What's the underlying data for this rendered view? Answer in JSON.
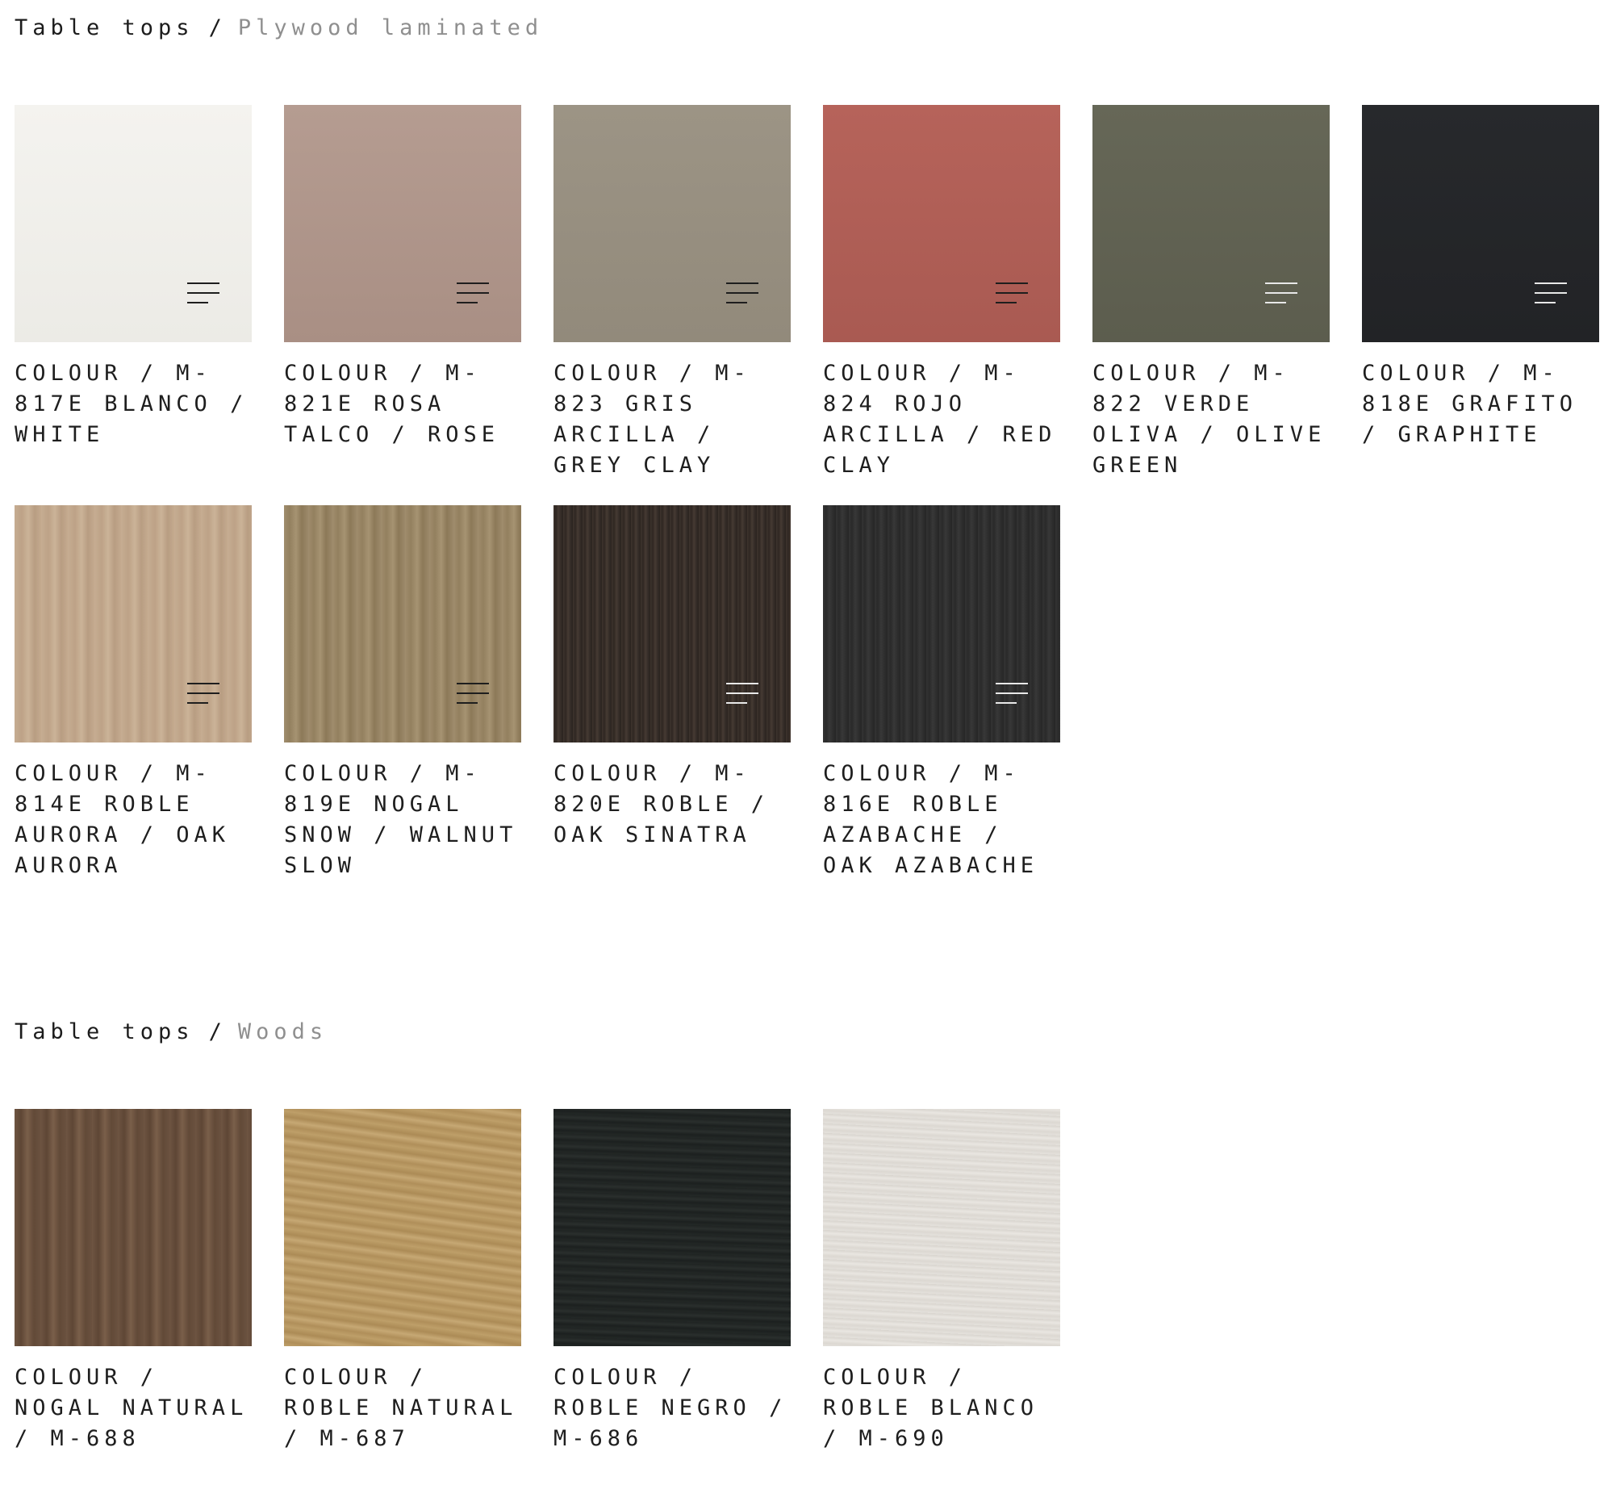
{
  "sections": [
    {
      "breadcrumb": {
        "main": "Table tops",
        "sep": "/",
        "sub": "Plywood laminated"
      },
      "items": [
        {
          "label": "COLOUR / M-817E BLANCO / WHITE",
          "swatch": "linear-gradient(180deg,#f4f3ef 0%,#ecebe6 100%)",
          "icon_color": "#1e1e1e",
          "menu_icon": "menu-lines-icon"
        },
        {
          "label": "COLOUR / M-821E ROSA TALCO / ROSE",
          "swatch": "linear-gradient(180deg,#b59c91 0%,#a98f84 100%)",
          "icon_color": "#1e1e1e",
          "menu_icon": "menu-lines-icon"
        },
        {
          "label": "COLOUR / M-823 GRIS ARCILLA / GREY CLAY",
          "swatch": "linear-gradient(180deg,#9c9485 0%,#928a7b 100%)",
          "icon_color": "#1e1e1e",
          "menu_icon": "menu-lines-icon"
        },
        {
          "label": "COLOUR / M-824 ROJO ARCILLA / RED CLAY",
          "swatch": "linear-gradient(180deg,#b6635a 0%,#a95a52 100%)",
          "icon_color": "#1e1e1e",
          "menu_icon": "menu-lines-icon"
        },
        {
          "label": "COLOUR / M-822 VERDE OLIVA / OLIVE GREEN",
          "swatch": "linear-gradient(180deg,#666757 0%,#5c5d4e 100%)",
          "icon_color": "#e8e8e8",
          "menu_icon": "menu-lines-icon"
        },
        {
          "label": "COLOUR / M-818E GRAFITO / GRAPHITE",
          "swatch": "linear-gradient(180deg,#27292c 0%,#222326 100%)",
          "icon_color": "#e8e8e8",
          "menu_icon": "menu-lines-icon"
        },
        {
          "label": "COLOUR / M-814E ROBLE AURORA / OAK AURORA",
          "swatch": "repeating-linear-gradient(90deg,#c6ad92 0px,#bda287 9px,#cbb398 17px,#b89d82 25px,#c4aa8f 33px)",
          "icon_color": "#1e1e1e",
          "menu_icon": "menu-lines-icon"
        },
        {
          "label": "COLOUR / M-819E NOGAL SNOW / WALNUT SLOW",
          "swatch": "repeating-linear-gradient(90deg,#a08d6d 0px,#93805f 7px,#a69372 15px,#8c7958 22px,#9c896a 30px)",
          "icon_color": "#1e1e1e",
          "menu_icon": "menu-lines-icon"
        },
        {
          "label": "COLOUR / M-820E ROBLE / OAK SINATRA",
          "swatch": "repeating-linear-gradient(90deg,#3e342e 0px,#2f2722 3px,#463a33 6px,#352d28 9px,#2a231f 12px)",
          "icon_color": "#e8e8e8",
          "menu_icon": "menu-lines-icon"
        },
        {
          "label": "COLOUR / M-816E ROBLE AZABACHE / OAK AZABACHE",
          "swatch": "repeating-linear-gradient(90deg,#333333 0px,#2a2a2a 4px,#383838 8px,#2e2e2e 12px,#262626 16px)",
          "icon_color": "#e8e8e8",
          "menu_icon": "menu-lines-icon"
        }
      ]
    },
    {
      "breadcrumb": {
        "main": "Table tops",
        "sep": "/",
        "sub": "Woods"
      },
      "items": [
        {
          "label": "COLOUR / NOGAL NATURAL / M-688",
          "swatch": "repeating-linear-gradient(90deg,#6e5542 0px,#5e4635 8px,#7a5f4a 16px,#624a38 24px,#6a513f 32px)",
          "icon_color": "",
          "menu_icon": ""
        },
        {
          "label": "COLOUR / ROBLE NATURAL / M-687",
          "swatch": "repeating-linear-gradient(8deg,#bfa06a 0px,#b08f5a 6px,#c6a874 12px,#ac8b56 18px,#bb9c66 24px)",
          "icon_color": "",
          "menu_icon": ""
        },
        {
          "label": "COLOUR / ROBLE NEGRO / M-686",
          "swatch": "repeating-linear-gradient(2deg,#232826 0px,#1c201f 4px,#2a2f2d 8px,#1f2322 12px)",
          "icon_color": "",
          "menu_icon": ""
        },
        {
          "label": "COLOUR / ROBLE BLANCO / M-690",
          "swatch": "repeating-linear-gradient(3deg,#e4e1dc 0px,#dcd8d2 4px,#e9e6e1 8px,#d8d4ce 12px)",
          "icon_color": "",
          "menu_icon": ""
        }
      ]
    }
  ]
}
